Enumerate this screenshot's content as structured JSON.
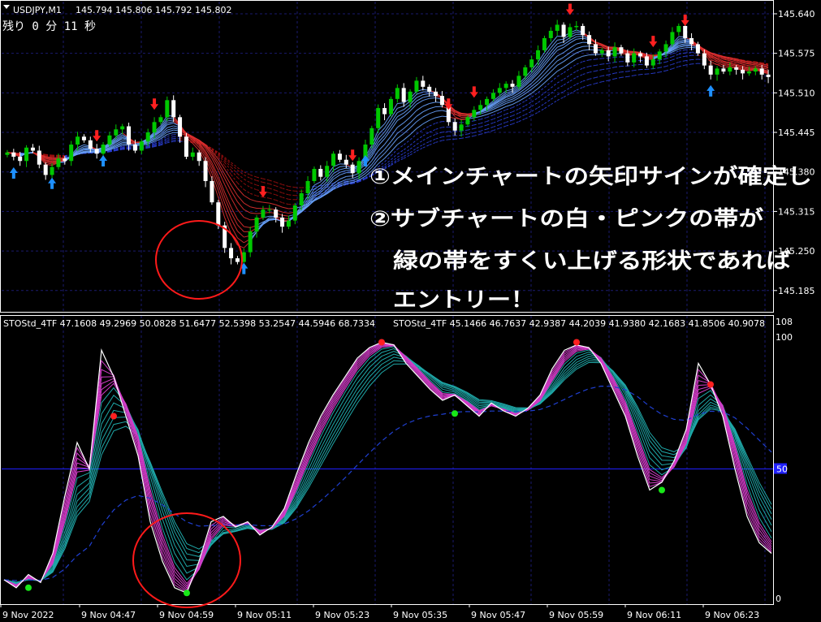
{
  "header": {
    "symbol": "USDJPY,M1",
    "ohlc": "145.794 145.806 145.792 145.802",
    "countdown": "残り 0 分 11 秒"
  },
  "sub_header": {
    "left": "STOStd_4TF 47.1608 49.2969 50.0828 51.6477 52.5398 53.2547 44.5946 68.7334",
    "right": "STOStd_4TF 45.1466 46.7637 42.9387 44.2039 41.9380 42.1683 41.8506 40.9078"
  },
  "annotation": {
    "line1": "①メインチャートの矢印サインが確定し",
    "line2": "②サブチャートの白・ピンクの帯が",
    "line3": "緑の帯をすくい上げる形状であれば",
    "line4": "エントリー！"
  },
  "colors": {
    "background": "#000000",
    "bull": "#00c800",
    "bear": "#ffffff",
    "up_arrow": "#1e90ff",
    "down_arrow": "#ff2020",
    "circle": "#ff1a1a",
    "level_50": "#1f1fff",
    "grid": "#1a1a6e"
  },
  "chart_data": [
    {
      "type": "candlestick",
      "title": "USDJPY,M1",
      "ylim": [
        145.15,
        145.66
      ],
      "y_ticks": [
        "145.640",
        "145.575",
        "145.510",
        "145.445",
        "145.380",
        "145.315",
        "145.250",
        "145.185"
      ],
      "x_ticks": [
        "9 Nov 2022",
        "9 Nov 04:47",
        "9 Nov 04:59",
        "9 Nov 05:11",
        "9 Nov 05:23",
        "9 Nov 05:35",
        "9 Nov 05:47",
        "9 Nov 05:59",
        "9 Nov 06:11",
        "9 Nov 06:23"
      ],
      "close": [
        145.412,
        145.405,
        145.398,
        145.42,
        145.415,
        145.392,
        145.375,
        145.388,
        145.402,
        145.398,
        145.425,
        145.438,
        145.432,
        145.418,
        145.41,
        145.425,
        145.44,
        145.45,
        145.455,
        145.425,
        145.415,
        145.43,
        145.445,
        145.462,
        145.47,
        145.498,
        145.47,
        145.438,
        145.405,
        145.412,
        145.398,
        145.365,
        145.33,
        145.292,
        145.255,
        145.238,
        145.232,
        145.248,
        145.282,
        145.305,
        145.318,
        145.318,
        145.305,
        145.29,
        145.3,
        145.325,
        145.345,
        145.365,
        145.385,
        145.372,
        145.39,
        145.41,
        145.4,
        145.392,
        145.378,
        145.398,
        145.425,
        145.452,
        145.485,
        145.475,
        145.5,
        145.518,
        145.495,
        145.512,
        145.53,
        145.52,
        145.512,
        145.505,
        145.49,
        145.462,
        145.448,
        145.458,
        145.47,
        145.482,
        145.49,
        145.5,
        145.51,
        145.518,
        145.525,
        145.52,
        145.538,
        145.552,
        145.565,
        145.58,
        145.6,
        145.612,
        145.622,
        145.602,
        145.618,
        145.62,
        145.605,
        145.59,
        145.575,
        145.58,
        145.57,
        145.585,
        145.575,
        145.56,
        145.575,
        145.57,
        145.555,
        145.565,
        145.578,
        145.59,
        145.61,
        145.62,
        145.6,
        145.59,
        145.575,
        145.555,
        145.54,
        145.55,
        145.545,
        145.552,
        145.548,
        145.542,
        145.545,
        145.55,
        145.54,
        145.536
      ],
      "series": [
        {
          "name": "arrow_up",
          "indices": [
            1,
            7,
            15,
            37,
            56,
            110
          ]
        },
        {
          "name": "arrow_down",
          "indices": [
            14,
            23,
            40,
            54,
            69,
            73,
            88,
            101,
            106
          ]
        }
      ]
    },
    {
      "type": "line",
      "title": "STOStd_4TF",
      "ylim": [
        0,
        100
      ],
      "y_ticks": [
        "100",
        "50",
        "0"
      ],
      "level": 50,
      "white_line": [
        8,
        5,
        10,
        7,
        18,
        40,
        60,
        50,
        95,
        85,
        70,
        55,
        30,
        15,
        5,
        3,
        15,
        30,
        32,
        28,
        30,
        25,
        28,
        35,
        48,
        60,
        70,
        78,
        85,
        92,
        96,
        98,
        97,
        90,
        85,
        80,
        76,
        78,
        74,
        70,
        75,
        72,
        70,
        73,
        78,
        88,
        95,
        97,
        96,
        90,
        80,
        70,
        55,
        42,
        45,
        53,
        65,
        90,
        82,
        70,
        50,
        32,
        22,
        18
      ],
      "green_dots": [
        {
          "x": 2,
          "y": 5
        },
        {
          "x": 15,
          "y": 3
        },
        {
          "x": 37,
          "y": 71
        },
        {
          "x": 54,
          "y": 42
        }
      ],
      "red_dots": [
        {
          "x": 9,
          "y": 70
        },
        {
          "x": 31,
          "y": 98
        },
        {
          "x": 47,
          "y": 98
        },
        {
          "x": 58,
          "y": 82
        }
      ]
    }
  ]
}
